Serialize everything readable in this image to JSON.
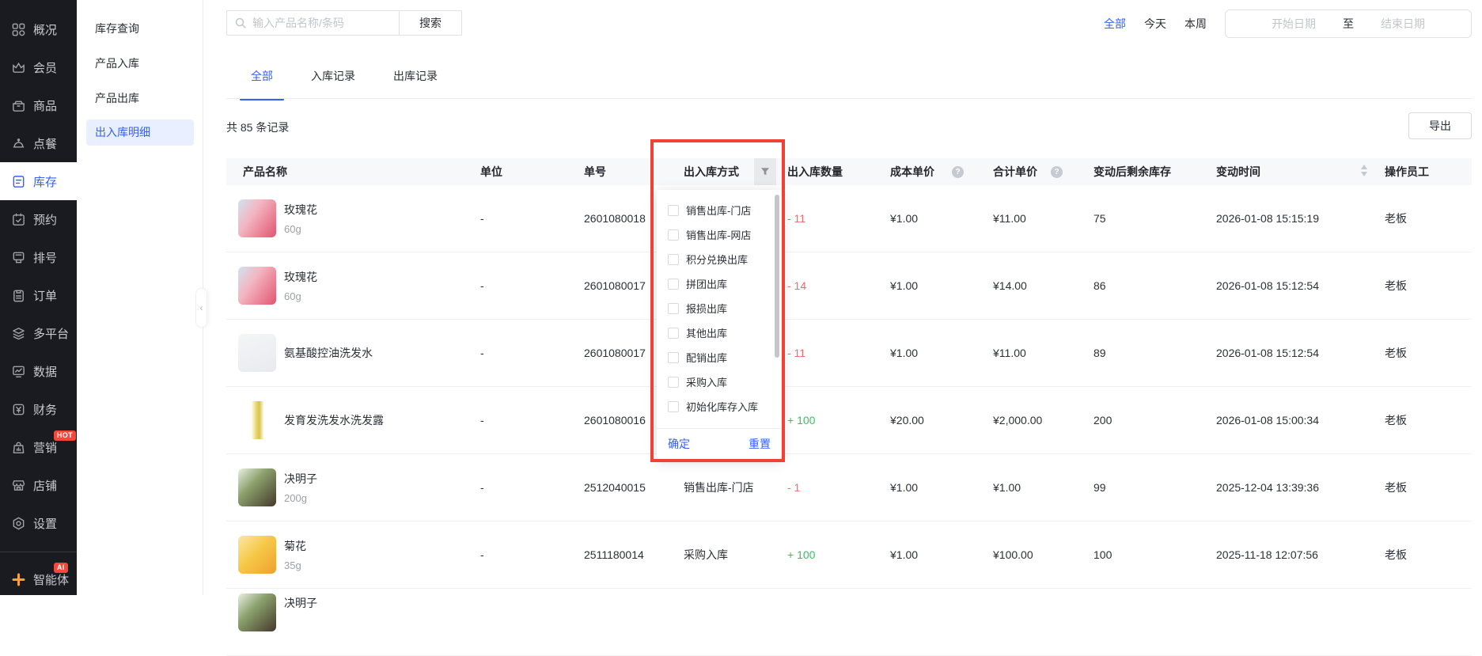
{
  "colors": {
    "accent_blue": "#3860f4",
    "badge_red": "#f5483b",
    "negative": "#f56a6a",
    "positive": "#38c25d",
    "annotation_red": "#f04134",
    "agent_orange": "#ff9d3b"
  },
  "sidebar": {
    "items": [
      {
        "label": "概况",
        "icon": "grid-icon"
      },
      {
        "label": "会员",
        "icon": "crown-icon"
      },
      {
        "label": "商品",
        "icon": "goods-icon"
      },
      {
        "label": "点餐",
        "icon": "dish-icon"
      },
      {
        "label": "库存",
        "icon": "inventory-icon",
        "active": true
      },
      {
        "label": "预约",
        "icon": "calendar-check-icon"
      },
      {
        "label": "排号",
        "icon": "queue-ticket-icon"
      },
      {
        "label": "订单",
        "icon": "clipboard-icon"
      },
      {
        "label": "多平台",
        "icon": "layers-icon"
      },
      {
        "label": "数据",
        "icon": "monitor-chart-icon"
      },
      {
        "label": "财务",
        "icon": "finance-yuan-icon"
      },
      {
        "label": "营销",
        "icon": "marketing-bag-icon",
        "badge": "HOT"
      },
      {
        "label": "店铺",
        "icon": "storefront-icon"
      },
      {
        "label": "设置",
        "icon": "settings-icon"
      }
    ],
    "agent": {
      "label": "智能体",
      "icon": "agent-clover-icon",
      "badge": "AI"
    }
  },
  "submenu": {
    "items": [
      {
        "label": "库存查询"
      },
      {
        "label": "产品入库"
      },
      {
        "label": "产品出库"
      },
      {
        "label": "出入库明细",
        "active": true
      }
    ]
  },
  "toolbar": {
    "search_placeholder": "输入产品名称/条码",
    "search_button": "搜索",
    "quick_filters": [
      {
        "label": "全部",
        "active": true
      },
      {
        "label": "今天"
      },
      {
        "label": "本周"
      }
    ],
    "date_start_placeholder": "开始日期",
    "date_separator": "至",
    "date_end_placeholder": "结束日期"
  },
  "tabs": [
    {
      "label": "全部",
      "active": true
    },
    {
      "label": "入库记录"
    },
    {
      "label": "出库记录"
    }
  ],
  "summary": {
    "count_text": "共 85 条记录",
    "export_label": "导出"
  },
  "table": {
    "columns": [
      "产品名称",
      "单位",
      "单号",
      "出入库方式",
      "出入库数量",
      "成本单价",
      "合计单价",
      "变动后剩余库存",
      "变动时间",
      "操作员工"
    ],
    "rows": [
      {
        "name": "玫瑰花",
        "spec": "60g",
        "image": "rose",
        "unit": "-",
        "order_no": "2601080018",
        "method": "",
        "qty": "- 11",
        "cost": "¥1.00",
        "total": "¥11.00",
        "remain": "75",
        "time": "2026-01-08 15:15:19",
        "operator": "老板"
      },
      {
        "name": "玫瑰花",
        "spec": "60g",
        "image": "rose",
        "unit": "-",
        "order_no": "2601080017",
        "method": "",
        "qty": "- 14",
        "cost": "¥1.00",
        "total": "¥14.00",
        "remain": "86",
        "time": "2026-01-08 15:12:54",
        "operator": "老板"
      },
      {
        "name": "氨基酸控油洗发水",
        "spec": "",
        "image": "shampoo",
        "unit": "-",
        "order_no": "2601080017",
        "method": "",
        "qty": "- 11",
        "cost": "¥1.00",
        "total": "¥11.00",
        "remain": "89",
        "time": "2026-01-08 15:12:54",
        "operator": "老板"
      },
      {
        "name": "发育发洗发水洗发露",
        "spec": "",
        "image": "yellowbottle",
        "unit": "-",
        "order_no": "2601080016",
        "method": "",
        "qty": "+ 100",
        "cost": "¥20.00",
        "total": "¥2,000.00",
        "remain": "200",
        "time": "2026-01-08 15:00:34",
        "operator": "老板"
      },
      {
        "name": "决明子",
        "spec": "200g",
        "image": "seeds",
        "unit": "-",
        "order_no": "2512040015",
        "method": "销售出库-门店",
        "qty": "- 1",
        "cost": "¥1.00",
        "total": "¥1.00",
        "remain": "99",
        "time": "2025-12-04 13:39:36",
        "operator": "老板"
      },
      {
        "name": "菊花",
        "spec": "35g",
        "image": "chrys",
        "unit": "-",
        "order_no": "2511180014",
        "method": "采购入库",
        "qty": "+ 100",
        "cost": "¥1.00",
        "total": "¥100.00",
        "remain": "100",
        "time": "2025-11-18 12:07:56",
        "operator": "老板"
      },
      {
        "name": "决明子",
        "spec": "",
        "image": "seeds",
        "unit": "",
        "order_no": "",
        "method": "",
        "qty": "",
        "cost": "",
        "total": "",
        "remain": "",
        "time": "",
        "operator": "",
        "partial": true
      }
    ]
  },
  "filter_dropdown": {
    "options": [
      "销售出库-门店",
      "销售出库-网店",
      "积分兑换出库",
      "拼团出库",
      "报损出库",
      "其他出库",
      "配销出库",
      "采购入库",
      "初始化库存入库"
    ],
    "confirm_label": "确定",
    "reset_label": "重置"
  }
}
